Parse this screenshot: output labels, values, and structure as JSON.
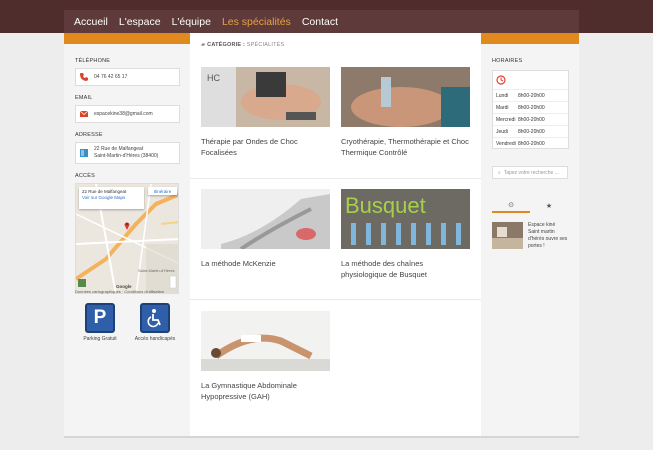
{
  "nav": {
    "items": [
      {
        "label": "Accueil",
        "active": false
      },
      {
        "label": "L'espace",
        "active": false
      },
      {
        "label": "L'équipe",
        "active": false
      },
      {
        "label": "Les spécialités",
        "active": true
      },
      {
        "label": "Contact",
        "active": false
      }
    ]
  },
  "contact": {
    "phone_label": "TÉLÉPHONE",
    "phone": "04 76 42 65 17",
    "email_label": "EMAIL",
    "email": "espacekine38@gmail.com",
    "address_label": "ADRESSE",
    "address_line1": "22 Rue de Malfangeat",
    "address_line2": "Saint-Martin-d'Hères (38400)",
    "access_label": "ACCÈS"
  },
  "map": {
    "card_title": "22 Rue de Malfangeat",
    "card_link": "Voir sur Google Maps",
    "directions": "Itinéraire",
    "town": "Saint-Martin-d'Hères",
    "brand": "Google",
    "footer": "Données cartographiques · Conditions d'utilisation"
  },
  "badges": {
    "parking": "Parking Gratuit",
    "access": "Accès handicapés"
  },
  "breadcrumb": {
    "prefix": "CATÉGORIE :",
    "current": "SPÉCIALITÉS"
  },
  "posts": [
    {
      "title": "Thérapie par Ondes de Choc Focalisées"
    },
    {
      "title": "Cryothérapie, Thermothérapie et Choc Thermique Contrôlé"
    },
    {
      "title": "La méthode McKenzie"
    },
    {
      "title": "La méthode des chaînes physiologique de Busquet"
    },
    {
      "title": "La Gymnastique Abdominale Hypopressive (GAH)"
    }
  ],
  "thumb_text": {
    "busquet": "Busquet",
    "device": "HC"
  },
  "hours": {
    "label": "HORAIRES",
    "rows": [
      {
        "day": "Lundi",
        "time": "8h00-20h00"
      },
      {
        "day": "Mardi",
        "time": "8h00-20h00"
      },
      {
        "day": "Mercredi",
        "time": "8h00-20h00"
      },
      {
        "day": "Jeudi",
        "time": "8h00-20h00"
      },
      {
        "day": "Vendredi",
        "time": "8h00-20h00"
      }
    ]
  },
  "search": {
    "placeholder": "Tapez votre recherche ..."
  },
  "widget_tabs": [
    {
      "icon": "clock-icon",
      "glyph": "⊙"
    },
    {
      "icon": "star-icon",
      "glyph": "★"
    }
  ],
  "recent_post": {
    "title": "Espace kiné Saint martin d'hérès ouvre ses portes !"
  },
  "colors": {
    "brand_dark": "#4f2d2d",
    "nav": "#5e3a3a",
    "accent": "#e08a1e",
    "active": "#e8a33c"
  }
}
